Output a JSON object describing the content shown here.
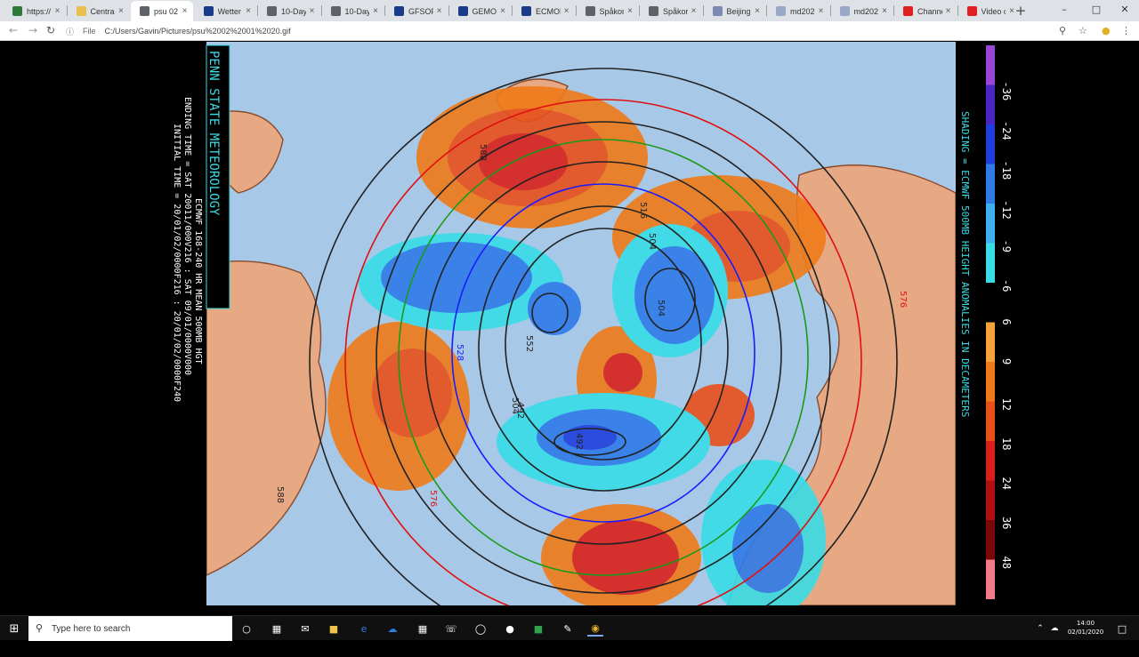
{
  "tabs": [
    {
      "title": "https://",
      "favicon_color": "#2f7a3a"
    },
    {
      "title": "Central",
      "favicon_color": "#e8c04a"
    },
    {
      "title": "psu 02",
      "favicon_color": "#5f6368",
      "active": true
    },
    {
      "title": "Wetter",
      "favicon_color": "#1a3a8a"
    },
    {
      "title": "10-Day",
      "favicon_color": "#5f6368"
    },
    {
      "title": "10-Day",
      "favicon_color": "#5f6368"
    },
    {
      "title": "GFSOP",
      "favicon_color": "#1a3a8a"
    },
    {
      "title": "GEMOP",
      "favicon_color": "#1a3a8a"
    },
    {
      "title": "ECMOP",
      "favicon_color": "#1a3a8a"
    },
    {
      "title": "Spåkort",
      "favicon_color": "#5f6368"
    },
    {
      "title": "Spåkort",
      "favicon_color": "#5f6368"
    },
    {
      "title": "Beijing",
      "favicon_color": "#7a8ab0"
    },
    {
      "title": "md202",
      "favicon_color": "#9aa8c8"
    },
    {
      "title": "md202",
      "favicon_color": "#9aa8c8"
    },
    {
      "title": "Channe",
      "favicon_color": "#e02020"
    },
    {
      "title": "Video o",
      "favicon_color": "#e02020"
    }
  ],
  "address": {
    "info_label": "File",
    "url": "C:/Users/Gavin/Pictures/psu%2002%2001%2020.gif"
  },
  "chart": {
    "brand": "PENN STATE METEOROLOGY",
    "header_line1": "ECMWF 168-240 HR MEAN 500MB HGT",
    "header_line2": "ENDING TIME = SAT 20011/000V216 : SAT 09/01/0000V000",
    "header_line3": "INITIAL TIME = 20/01/02/0000F216 : 20/01/02/0000F240",
    "shading_label": "SHADING = ECMWF 500MB HEIGHT ANOMALIES IN DECAMETERS",
    "contour_labels": [
      "588",
      "588",
      "576",
      "576",
      "528",
      "504",
      "504",
      "492",
      "516",
      "504",
      "552",
      "492"
    ],
    "legend": [
      {
        "label": "-36",
        "color": "#9b45d6"
      },
      {
        "label": "-24",
        "color": "#4a25c4"
      },
      {
        "label": "-18",
        "color": "#1f3fdc"
      },
      {
        "label": "-12",
        "color": "#2f7be8"
      },
      {
        "label": "-9",
        "color": "#3fb0ee"
      },
      {
        "label": "-6",
        "color": "#38dde6"
      },
      {
        "label": "6",
        "color": "#000000"
      },
      {
        "label": "9",
        "color": "#f6a43a"
      },
      {
        "label": "12",
        "color": "#f07a18"
      },
      {
        "label": "18",
        "color": "#e8501a"
      },
      {
        "label": "24",
        "color": "#d8201a"
      },
      {
        "label": "36",
        "color": "#b00f0f"
      },
      {
        "label": "48",
        "color": "#7a0808"
      },
      {
        "label": "",
        "color": "#f07a8a"
      }
    ]
  },
  "taskbar": {
    "search_placeholder": "Type here to search",
    "time": "14:00",
    "date": "02/01/2020"
  }
}
